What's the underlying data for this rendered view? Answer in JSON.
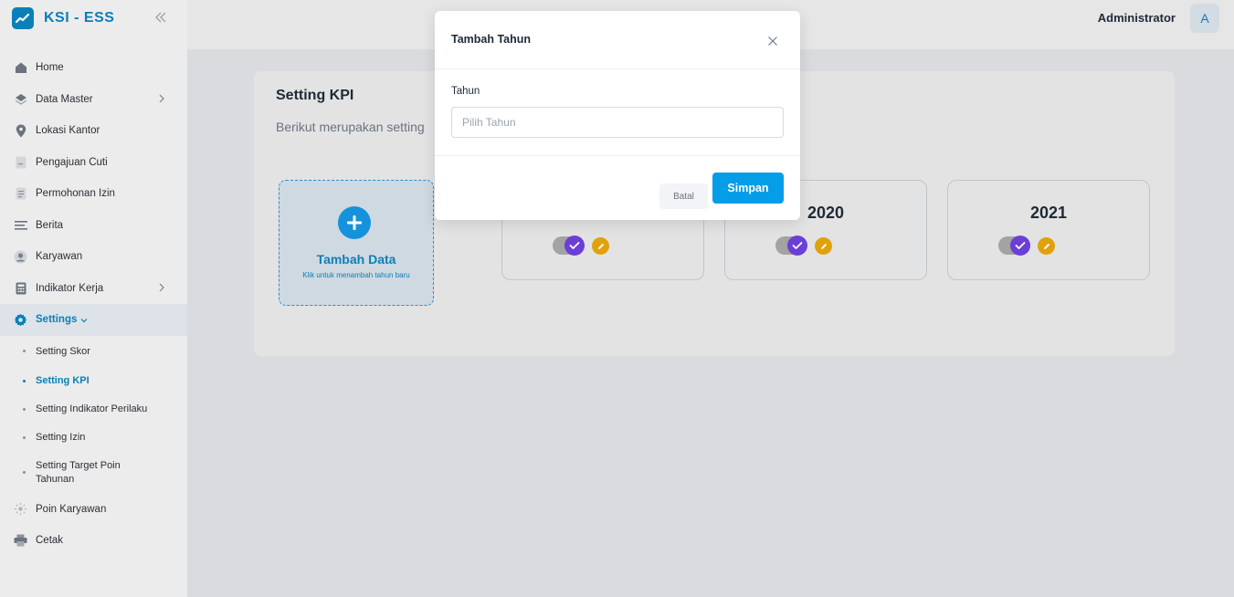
{
  "app": {
    "brand": "KSI - ESS"
  },
  "sidebar": {
    "items": [
      {
        "label": "Home",
        "icon": "home-icon"
      },
      {
        "label": "Data Master",
        "icon": "layers-icon",
        "has_children": true
      },
      {
        "label": "Lokasi Kantor",
        "icon": "map-pin-icon"
      },
      {
        "label": "Pengajuan Cuti",
        "icon": "document-icon"
      },
      {
        "label": "Permohonan Izin",
        "icon": "file-text-icon"
      },
      {
        "label": "Berita",
        "icon": "news-icon"
      },
      {
        "label": "Karyawan",
        "icon": "user-icon"
      },
      {
        "label": "Indikator Kerja",
        "icon": "calculator-icon",
        "has_children": true
      },
      {
        "label": "Settings",
        "icon": "gear-icon",
        "expanded": true,
        "active": true
      }
    ],
    "settings_children": [
      {
        "label": "Setting Skor"
      },
      {
        "label": "Setting KPI",
        "active": true
      },
      {
        "label": "Setting Indikator Perilaku"
      },
      {
        "label": "Setting Izin"
      },
      {
        "label": "Setting Target Poin Tahunan"
      }
    ],
    "bottom_items": [
      {
        "label": "Poin Karyawan",
        "icon": "star-icon"
      },
      {
        "label": "Cetak",
        "icon": "printer-icon"
      }
    ]
  },
  "topbar": {
    "user_name": "Administrator",
    "avatar_initial": "A"
  },
  "page": {
    "title": "Setting KPI",
    "subtitle": "Berikut merupakan setting",
    "add_card": {
      "title": "Tambah Data",
      "subtitle": "Klik untuk menambah tahun baru"
    },
    "years": [
      "2020",
      "2021"
    ]
  },
  "modal": {
    "title": "Tambah Tahun",
    "field_label": "Tahun",
    "field_placeholder": "Pilih Tahun",
    "field_value": "",
    "cancel_label": "Batal",
    "save_label": "Simpan"
  },
  "colors": {
    "brand": "#0b7fb8",
    "primary_button": "#049de8",
    "toggle_knob": "#6b3fd6",
    "edit_button": "#e0a10d"
  }
}
